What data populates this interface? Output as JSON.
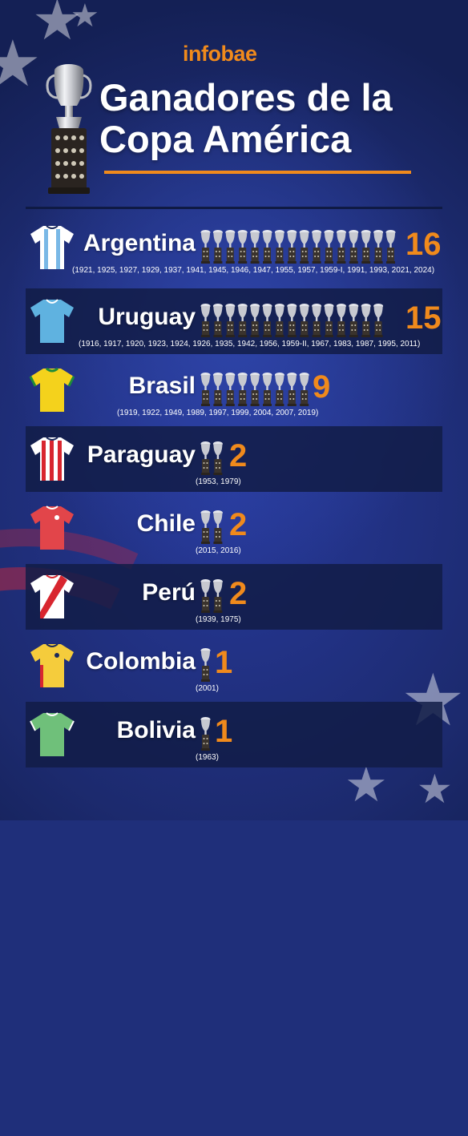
{
  "brand": "infobae",
  "title": {
    "line1": "Ganadores de la",
    "line2": "Copa América"
  },
  "colors": {
    "accent": "#f08a1c",
    "text": "#ffffff",
    "background": "#1f2f7a",
    "row_dark": "#121c46"
  },
  "winners": [
    {
      "country": "Argentina",
      "titles": "16",
      "trophies": 16,
      "jersey": "argentina-jersey-icon",
      "years": "(1921, 1925, 1927, 1929, 1937, 1941, 1945, 1946, 1947, 1955, 1957, 1959-I, 1991, 1993, 2021, 2024)"
    },
    {
      "country": "Uruguay",
      "titles": "15",
      "trophies": 15,
      "jersey": "uruguay-jersey-icon",
      "years": "(1916, 1917, 1920, 1923, 1924, 1926, 1935, 1942, 1956, 1959-II, 1967, 1983, 1987, 1995, 2011)"
    },
    {
      "country": "Brasil",
      "titles": "9",
      "trophies": 9,
      "jersey": "brasil-jersey-icon",
      "years": "(1919, 1922, 1949, 1989, 1997, 1999, 2004, 2007, 2019)"
    },
    {
      "country": "Paraguay",
      "titles": "2",
      "trophies": 2,
      "jersey": "paraguay-jersey-icon",
      "years": "(1953, 1979)"
    },
    {
      "country": "Chile",
      "titles": "2",
      "trophies": 2,
      "jersey": "chile-jersey-icon",
      "years": "(2015, 2016)"
    },
    {
      "country": "Perú",
      "titles": "2",
      "trophies": 2,
      "jersey": "peru-jersey-icon",
      "years": "(1939, 1975)"
    },
    {
      "country": "Colombia",
      "titles": "1",
      "trophies": 1,
      "jersey": "colombia-jersey-icon",
      "years": "(2001)"
    },
    {
      "country": "Bolivia",
      "titles": "1",
      "trophies": 1,
      "jersey": "bolivia-jersey-icon",
      "years": "(1963)"
    }
  ]
}
